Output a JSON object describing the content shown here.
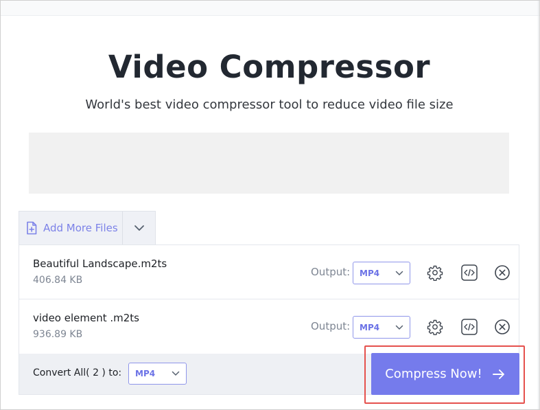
{
  "header": {
    "title": "Video Compressor",
    "subtitle": "World's best video compressor tool to reduce video file size"
  },
  "toolbar": {
    "add_more_label": "Add More Files"
  },
  "files": [
    {
      "name": "Beautiful Landscape.m2ts",
      "size": "406.84 KB",
      "output_label": "Output:",
      "format": "MP4"
    },
    {
      "name": "video element .m2ts",
      "size": "936.89 KB",
      "output_label": "Output:",
      "format": "MP4"
    }
  ],
  "footer": {
    "convert_all_label": "Convert All( 2 ) to:",
    "convert_all_format": "MP4",
    "compress_label": "Compress Now!"
  },
  "colors": {
    "accent": "#757bec",
    "accent_text": "#6b72e6",
    "highlight": "#e5504c"
  },
  "icons": {
    "add_file": "file-plus-icon",
    "dropdown": "chevron-down-icon",
    "settings": "gear-icon",
    "embed": "code-icon",
    "remove": "close-circle-icon",
    "arrow": "arrow-right-icon"
  }
}
